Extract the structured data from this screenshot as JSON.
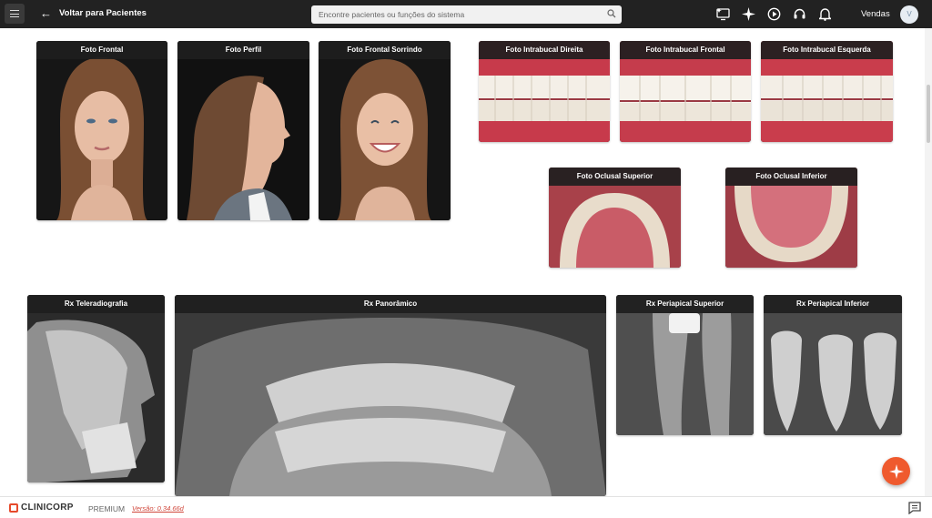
{
  "header": {
    "back_label": "Voltar para Pacientes",
    "search_placeholder": "Encontre pacientes ou funções do sistema",
    "user_name": "Vendas",
    "avatar_initial": "V",
    "icons": [
      "monitor-star-icon",
      "sparkle-icon",
      "play-circle-icon",
      "headset-icon",
      "bell-icon"
    ]
  },
  "photos": {
    "foto_frontal": "Foto Frontal",
    "foto_perfil": "Foto Perfil",
    "foto_frontal_sorrindo": "Foto Frontal Sorrindo",
    "intra_direita": "Foto Intrabucal Direita",
    "intra_frontal": "Foto Intrabucal Frontal",
    "intra_esquerda": "Foto Intrabucal Esquerda",
    "oclusal_superior": "Foto Oclusal Superior",
    "oclusal_inferior": "Foto Oclusal Inferior"
  },
  "xrays": {
    "teleradiografia": "Rx Teleradiografia",
    "panoramico": "Rx Panorâmico",
    "periapical_superior": "Rx Periapical Superior",
    "periapical_inferior": "Rx Periapical Inferior"
  },
  "footer": {
    "brand": "CLINICORP",
    "plan": "PREMIUM",
    "version": "Versão: 0.34.66d"
  },
  "colors": {
    "topbar": "#222222",
    "accent": "#ef5a2e",
    "version_link": "#d0463a"
  }
}
